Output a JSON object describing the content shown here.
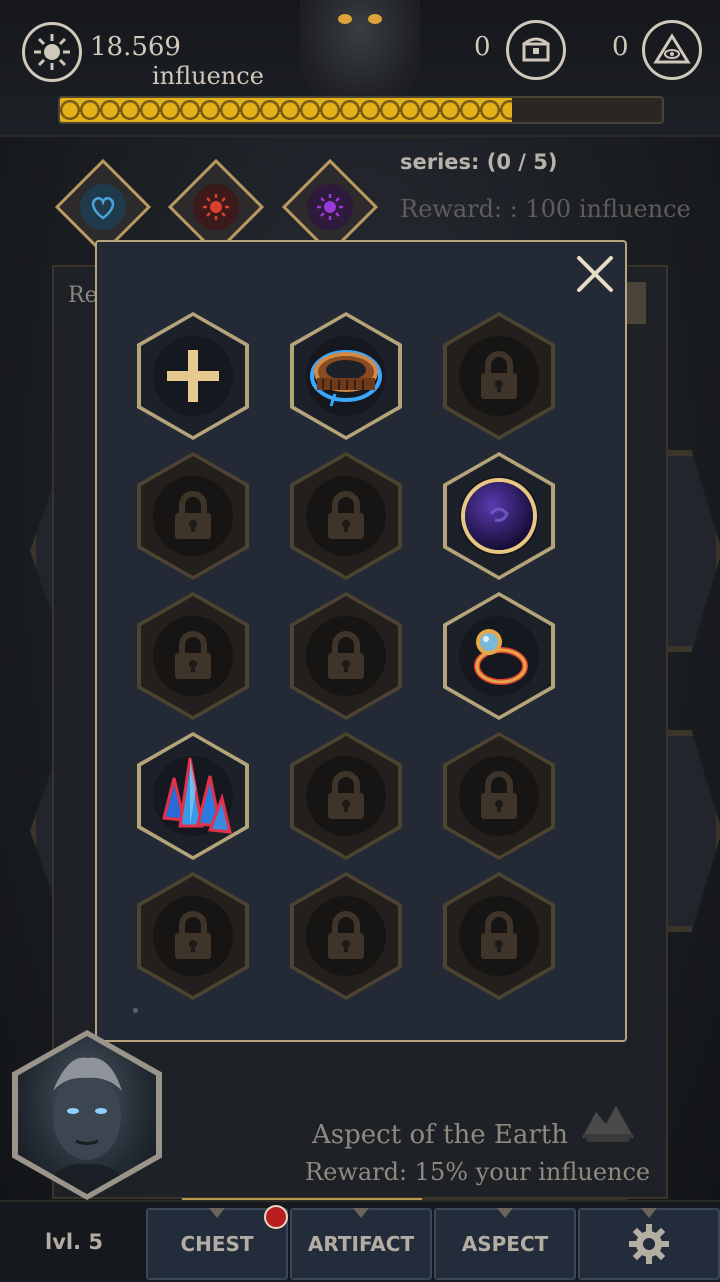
{
  "header": {
    "influence_value": "18.569",
    "influence_label": "influence",
    "chest_count": "0",
    "aspect_count": "0",
    "progress_fraction": 0.75
  },
  "series": {
    "text": "series: (0 / 5)",
    "reward": "Reward: : 100 influence",
    "icons": [
      "heart-icon",
      "sun-icon",
      "sun-purple-icon"
    ]
  },
  "underlying_panel": {
    "partial_label": "Re",
    "aspect_title": "Aspect of the Earth",
    "aspect_reward": "Reward:  15% your influence"
  },
  "modal": {
    "slots": [
      {
        "state": "add",
        "icon": "plus-icon"
      },
      {
        "state": "item",
        "icon": "bracelet-icon"
      },
      {
        "state": "locked",
        "icon": "lock-icon"
      },
      {
        "state": "locked",
        "icon": "lock-icon"
      },
      {
        "state": "locked",
        "icon": "lock-icon"
      },
      {
        "state": "item",
        "icon": "dark-orb-icon"
      },
      {
        "state": "locked",
        "icon": "lock-icon"
      },
      {
        "state": "locked",
        "icon": "lock-icon"
      },
      {
        "state": "item",
        "icon": "ring-icon"
      },
      {
        "state": "item",
        "icon": "crystal-icon"
      },
      {
        "state": "locked",
        "icon": "lock-icon"
      },
      {
        "state": "locked",
        "icon": "lock-icon"
      },
      {
        "state": "locked",
        "icon": "lock-icon"
      },
      {
        "state": "locked",
        "icon": "lock-icon"
      },
      {
        "state": "locked",
        "icon": "lock-icon"
      }
    ]
  },
  "footer": {
    "level": "lvl. 5",
    "tabs": [
      "CHEST",
      "ARTIFACT",
      "ASPECT"
    ],
    "settings_icon": "gear-icon",
    "xp_fraction": 0.54
  },
  "colors": {
    "gold": "#b5a37a",
    "modal_bg": "#232a35",
    "tab_bg": "#222c3a"
  }
}
